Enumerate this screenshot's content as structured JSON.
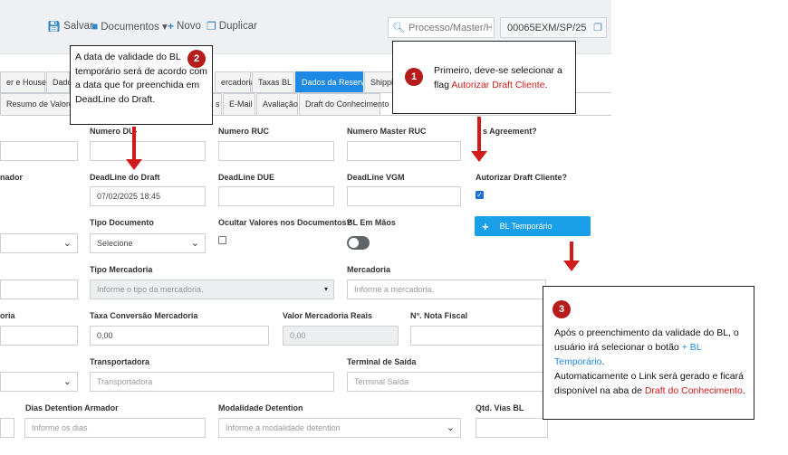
{
  "toolbar": {
    "save_label": "Salvar",
    "documents_label": "Documentos ▾",
    "new_label": "Novo",
    "duplicate_label": "Duplicar",
    "search_placeholder": "Processo/Master/Hou",
    "reference": "00065EXM/SP/25"
  },
  "tabs_row1": [
    "er e House",
    "Dados",
    "ercadoria",
    "Taxas BL",
    "Dados da Reserva",
    "Shippin"
  ],
  "tabs_row2": [
    "Resumo de Valores C",
    "s",
    "E-Mail",
    "Avaliação",
    "Draft do Conhecimento"
  ],
  "active_tab": "Dados da Reserva",
  "fields": {
    "numero_du_label": "Numero DU-",
    "numero_ruc_label": "Numero RUC",
    "numero_master_ruc_label": "Numero Master RUC",
    "agreement_label": "s Agreement?",
    "armador_label": "nador",
    "deadline_draft_label": "DeadLine do Draft",
    "deadline_draft_value": "07/02/2025 18:45",
    "deadline_due_label": "DeadLine DUE",
    "deadline_vgm_label": "DeadLine VGM",
    "autorizar_label": "Autorizar Draft Cliente?",
    "tipo_documento_label": "Tipo Documento",
    "tipo_documento_value": "Selecione",
    "ocultar_label": "Ocultar Valores nos Documentos?",
    "bl_em_maos_label": "BL Em Mãos",
    "bl_temporario_label": "BL Temporário",
    "tipo_mercadoria_label": "Tipo Mercadoria",
    "tipo_mercadoria_placeholder": "Informe o tipo da mercadoria.",
    "mercadoria_label": "Mercadoria",
    "mercadoria_placeholder": "Informe a mercadoria.",
    "oria_label": "oria",
    "taxa_conversao_label": "Taxa Conversão Mercadoria",
    "taxa_conversao_value": "0,00",
    "valor_reais_label": "Valor Mercadoria Reais",
    "valor_reais_value": "0,00",
    "nota_fiscal_label": "N°. Nota Fiscal",
    "transportadora_label": "Transportadora",
    "transportadora_placeholder": "Transportadora",
    "terminal_label": "Terminal de Saída",
    "terminal_placeholder": "Terminal Saída",
    "dias_detention_label": "Dias Detention Armador",
    "dias_detention_placeholder": "Informe os dias",
    "modalidade_label": "Modalidade Detention",
    "modalidade_placeholder": "Informe a modalidade detention",
    "qtd_vias_label": "Qtd. Vias BL"
  },
  "callouts": {
    "c1": {
      "number": "1",
      "text": "Primeiro, deve-se selecionar a flag",
      "highlight": "Autorizar Draft Cliente",
      "suffix": "."
    },
    "c2": {
      "number": "2",
      "text": "A data de validade do BL temporário será de acordo com a data que for preenchida em DeadLine do Draft."
    },
    "c3": {
      "number": "3",
      "line1": "Após o preenchimento da validade do BL, o usuário irá selecionar o botão",
      "line1_highlight": "+ BL Temporário",
      "line1_suffix": ".",
      "line2": "Automaticamente o Link será gerado e ficará disponível na aba de",
      "line2_highlight": "Draft do Conhecimento",
      "line2_suffix": "."
    }
  },
  "colors": {
    "accent": "#1e88e5",
    "button": "#1aa0e8",
    "annotation": "#d11a1a",
    "badge": "#b71c1c"
  }
}
